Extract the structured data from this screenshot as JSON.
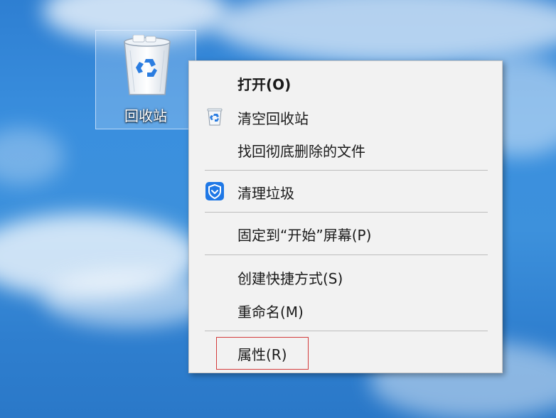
{
  "desktop": {
    "icon": {
      "label": "回收站",
      "icon_name": "recycle-bin-icon"
    }
  },
  "context_menu": {
    "items": [
      {
        "label": "打开(O)",
        "bold": true,
        "icon": null
      },
      {
        "label": "清空回收站",
        "icon": "recycle-bin-small-icon"
      },
      {
        "label": "找回彻底删除的文件",
        "icon": null
      },
      {
        "label": "清理垃圾",
        "icon": "shield-icon"
      },
      {
        "label": "固定到“开始”屏幕(P)",
        "icon": null
      },
      {
        "label": "创建快捷方式(S)",
        "icon": null
      },
      {
        "label": "重命名(M)",
        "icon": null
      },
      {
        "label": "属性(R)",
        "icon": null,
        "highlighted": true
      }
    ],
    "highlight_color": "#d43b3b",
    "shield_color": "#1f78e6"
  }
}
